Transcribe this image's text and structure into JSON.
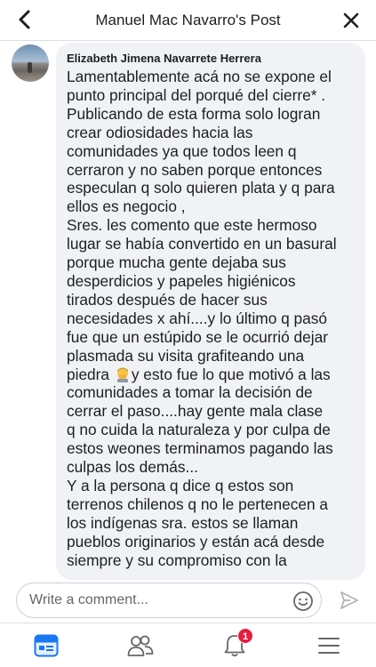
{
  "header": {
    "title": "Manuel Mac Navarro's Post",
    "back_icon": "chevron-left-icon",
    "close_icon": "close-icon"
  },
  "comment": {
    "author": "Elizabeth Jimena Navarrete Herrera",
    "lines": [
      "Lamentablemente acá no se expone el",
      "punto principal del porqué del cierre* .",
      " Publicando de esta forma solo logran",
      "crear odiosidades hacia las",
      "comunidades ya que todos leen q",
      "cerraron y no saben porque entonces",
      "especulan q solo quieren plata y q para",
      "ellos es negocio ,",
      "Sres. les comento que este hermoso",
      "lugar se había convertido en un basural",
      "porque mucha gente dejaba sus",
      "desperdicios y papeles higiénicos",
      "tirados después de hacer sus",
      "necesidades x ahí....y lo último q pasó",
      "fue que un estúpido se le ocurrió dejar",
      "plasmada su visita grafiteando una",
      "piedra",
      "y esto fue lo que motivó a las",
      "comunidades a tomar la decisión de",
      "cerrar el paso....hay gente mala  clase",
      "q no cuida la naturaleza y por culpa de",
      "estos weones terminamos pagando las",
      "culpas los demás...",
      " Y a la persona q dice q estos son",
      "terrenos chilenos q no le pertenecen a",
      "los indígenas sra. estos se llaman",
      "pueblos originarios y están acá desde",
      "siempre y su compromiso con la"
    ],
    "emoji_icon": "facepalm-emoji-icon"
  },
  "composer": {
    "placeholder": "Write a comment...",
    "emoji_icon": "smiley-icon",
    "send_icon": "send-icon"
  },
  "tabbar": {
    "items": [
      {
        "name": "news-feed",
        "icon": "news-feed-icon"
      },
      {
        "name": "friends",
        "icon": "friends-icon"
      },
      {
        "name": "notifications",
        "icon": "bell-icon",
        "badge": "1"
      },
      {
        "name": "menu",
        "icon": "menu-icon"
      }
    ]
  },
  "colors": {
    "accent": "#1877f2",
    "bubble": "#f0f2f5",
    "badge": "#e41e3f",
    "icon_gray": "#65676b"
  }
}
